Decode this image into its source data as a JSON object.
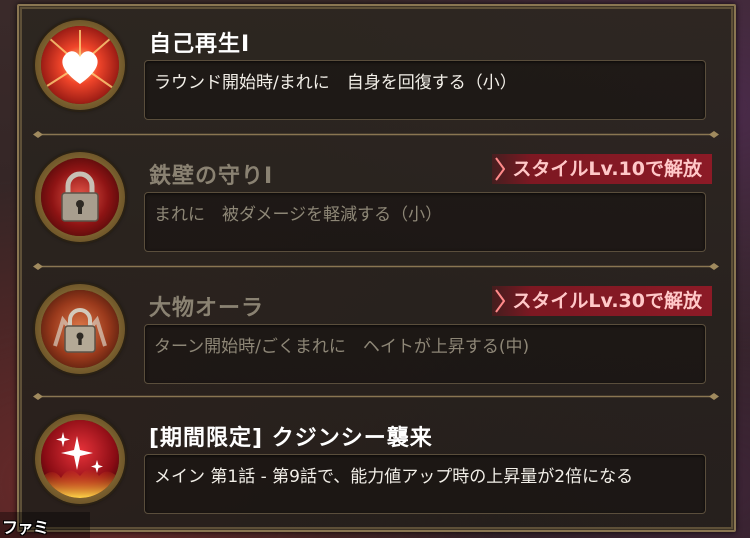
{
  "skills": [
    {
      "title": "自己再生Ⅰ",
      "description": "ラウンド開始時/まれに　自身を回復する（小）",
      "icon": "heart-icon",
      "locked": false,
      "unlock_label": ""
    },
    {
      "title": "鉄壁の守りⅠ",
      "description": "まれに　被ダメージを軽減する（小）",
      "icon": "padlock-icon",
      "locked": true,
      "unlock_label": "スタイルLv.10で解放"
    },
    {
      "title": "大物オーラ",
      "description": "ターン開始時/ごくまれに　ヘイトが上昇する(中)",
      "icon": "locked-figure-icon",
      "locked": true,
      "unlock_label": "スタイルLv.30で解放"
    },
    {
      "title": "[期間限定] クジンシー襲来",
      "description": "メイン 第1話 - 第9話で、能力値アップ時の上昇量が2倍になる",
      "icon": "sparkle-flame-icon",
      "locked": false,
      "unlock_label": ""
    }
  ],
  "watermark": "ファミ通.com",
  "colors": {
    "panel_border": "#8a7652",
    "unlock_badge": "#8c1a26",
    "title_active": "#ffffff",
    "title_locked": "#8a8272"
  }
}
